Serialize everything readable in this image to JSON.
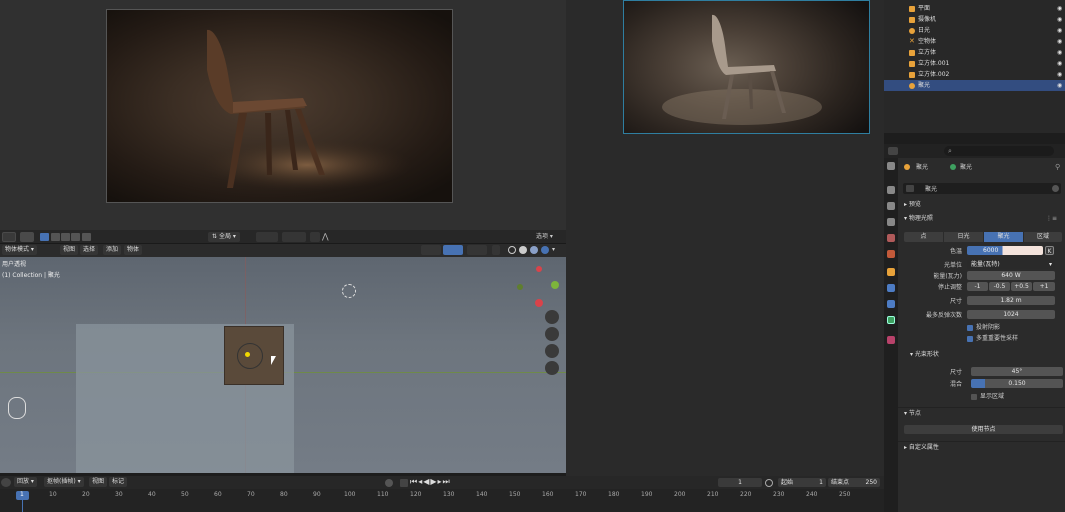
{
  "viewport": {
    "header_menus": [
      "物体模式",
      "视图",
      "选择",
      "添加",
      "物体"
    ],
    "transform_orientation": "全局",
    "options_label": "选项",
    "view_name": "用户透视",
    "collection_label": "(1) Collection | 聚光"
  },
  "outliner": {
    "items": [
      {
        "label": "平面",
        "icon_color": "#e8a23a"
      },
      {
        "label": "摄像机",
        "icon_color": "#e8a23a"
      },
      {
        "label": "日光",
        "icon_color": "#e8a23a"
      },
      {
        "label": "空物体",
        "icon_color": "#e8a23a"
      },
      {
        "label": "立方体",
        "icon_color": "#e8a23a"
      },
      {
        "label": "立方体.001",
        "icon_color": "#e8a23a"
      },
      {
        "label": "立方体.002",
        "icon_color": "#e8a23a"
      },
      {
        "label": "聚光",
        "icon_color": "#e8a23a"
      }
    ]
  },
  "properties": {
    "breadcrumb_obj": "聚光",
    "breadcrumb_data": "聚光",
    "datablock_name": "聚光",
    "section_preview": "预览",
    "section_light": "物理光照",
    "light_types": [
      "点",
      "日光",
      "聚光",
      "区域"
    ],
    "active_light_type": "聚光",
    "color_label": "色温",
    "color_value": "6000",
    "color_unit_btn": "K",
    "unit_label": "光单位",
    "unit_value": "能量(瓦特)",
    "power_label": "能量(瓦力)",
    "power_value": "640 W",
    "exposure_label": "停止调整",
    "exposure_buttons": [
      "-1",
      "-0.5",
      "+0.5",
      "+1"
    ],
    "size_label": "尺寸",
    "size_value": "1.82 m",
    "bounces_label": "最多反弹次数",
    "bounces_value": "1024",
    "cast_shadow_label": "投射阴影",
    "mis_label": "多重重要性采样",
    "beam_section": "光束形状",
    "spot_size_label": "尺寸",
    "spot_size_value": "45°",
    "blend_label": "混合",
    "blend_value": "0.150",
    "show_cone_label": "显示区域",
    "nodes_section": "节点",
    "use_nodes_button": "使用节点",
    "custom_props_section": "自定义属性",
    "accent_color": "#4772b3"
  },
  "timeline": {
    "playback_label": "回放",
    "keying_label": "抠帧(插帧)",
    "view_label": "视图",
    "marker_label": "标记",
    "current_frame": "1",
    "start_label": "起始",
    "start_value": "1",
    "end_label": "结束点",
    "end_value": "250",
    "ticks": [
      "1",
      "10",
      "20",
      "30",
      "40",
      "50",
      "60",
      "70",
      "80",
      "90",
      "100",
      "110",
      "120",
      "130",
      "140",
      "150",
      "160",
      "170",
      "180",
      "190",
      "200",
      "210",
      "220",
      "230",
      "240",
      "250"
    ]
  }
}
